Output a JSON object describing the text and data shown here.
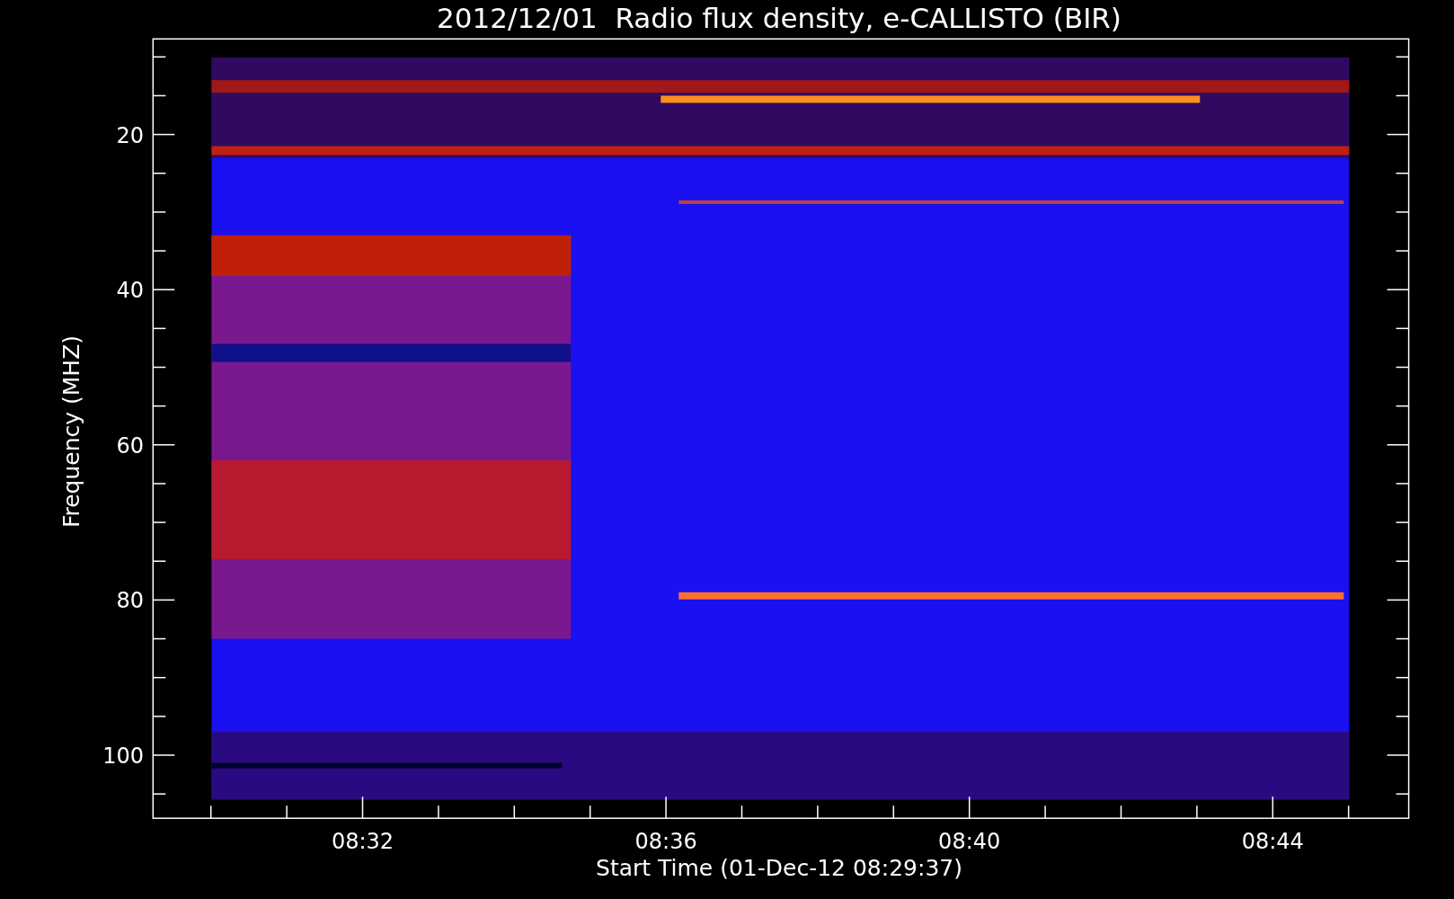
{
  "title": "2012/12/01  Radio flux density, e-CALLISTO (BIR)",
  "ylabel": "Frequency (MHZ)",
  "xlabel": "Start Time (01-Dec-12 08:29:37)",
  "yticks": [
    "20",
    "40",
    "60",
    "80",
    "100"
  ],
  "xticks": [
    "08:32",
    "08:36",
    "08:40",
    "08:44"
  ]
}
